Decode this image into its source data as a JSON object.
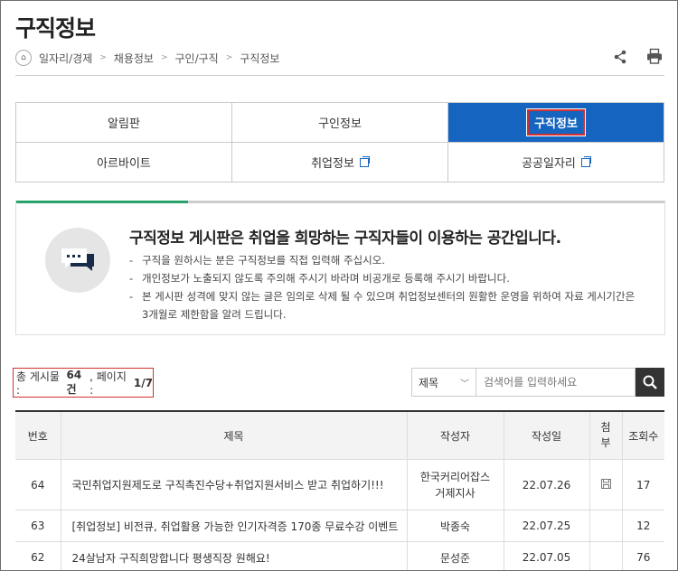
{
  "page_title": "구직정보",
  "breadcrumb": [
    "일자리/경제",
    "채용정보",
    "구인/구직",
    "구직정보"
  ],
  "tabs": [
    {
      "label": "알림판"
    },
    {
      "label": "구인정보"
    },
    {
      "label": "구직정보",
      "active": true
    },
    {
      "label": "아르바이트"
    },
    {
      "label": "취업정보",
      "external": true
    },
    {
      "label": "공공일자리",
      "external": true
    }
  ],
  "info": {
    "heading": "구직정보 게시판은 취업을 희망하는 구직자들이 이용하는 공간입니다.",
    "items": [
      "구직을 원하시는 분은 구직정보를 직접 입력해 주십시오.",
      "개인정보가 노출되지 않도록 주의해 주시기 바라며 비공개로 등록해 주시기 바랍니다.",
      "본 게시판 성격에 맞지 않는 글은 임의로 삭제 될 수 있으며 취업정보센터의 원활한 운영을 위하여 자료 게시기간은 3개월로 제한함을 알려 드립니다."
    ]
  },
  "count": {
    "prefix": "총 게시물 : ",
    "total": "64건",
    "mid": ", 페이지 : ",
    "page": "1/7"
  },
  "search": {
    "field": "제목",
    "placeholder": "검색어를 입력하세요"
  },
  "table": {
    "headers": [
      "번호",
      "제목",
      "작성자",
      "작성일",
      "첨부",
      "조회수"
    ],
    "rows": [
      {
        "no": "64",
        "title": "국민취업지원제도로 구직촉진수당+취업지원서비스 받고 취업하기!!!",
        "author": "한국커리어잡스 거제지사",
        "date": "22.07.26",
        "attach": true,
        "views": "17"
      },
      {
        "no": "63",
        "title": "[취업정보] 비전큐, 취업활용 가능한 인기자격증 170종 무료수강 이벤트",
        "author": "박종숙",
        "date": "22.07.25",
        "attach": false,
        "views": "12"
      },
      {
        "no": "62",
        "title": "24살남자 구직희망합니다 평생직장 원해요!",
        "author": "문성준",
        "date": "22.07.05",
        "attach": false,
        "views": "76"
      }
    ]
  },
  "colors": {
    "active_tab": "#1565c0",
    "highlight": "#d32f2f",
    "accent_green": "#25a36a"
  }
}
